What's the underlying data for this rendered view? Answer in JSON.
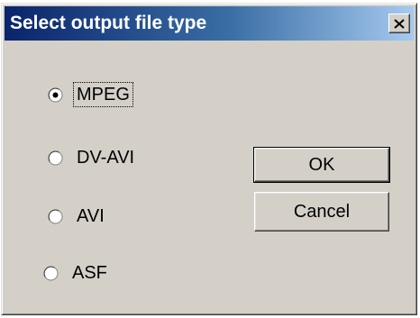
{
  "window": {
    "title": "Select output file type",
    "close_icon": "close-icon"
  },
  "options": [
    {
      "label": "MPEG",
      "selected": true
    },
    {
      "label": "DV-AVI",
      "selected": false
    },
    {
      "label": "AVI",
      "selected": false
    },
    {
      "label": "ASF",
      "selected": false
    }
  ],
  "buttons": {
    "ok": "OK",
    "cancel": "Cancel"
  },
  "colors": {
    "face": "#d4d0c8",
    "title_start": "#0a246a",
    "title_end": "#a6caf0"
  }
}
